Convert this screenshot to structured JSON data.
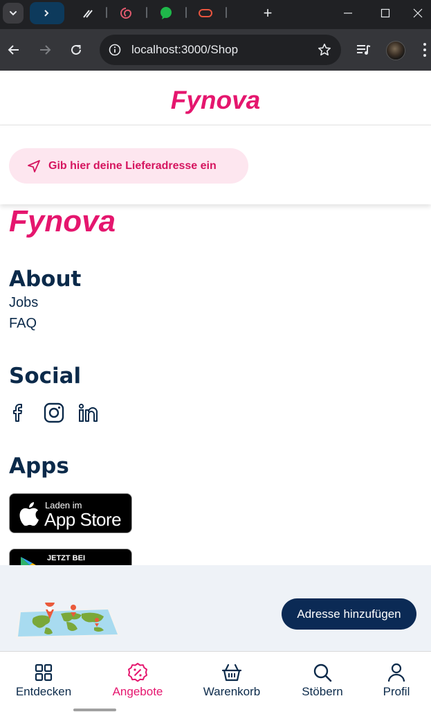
{
  "browser": {
    "url": "localhost:3000/Shop",
    "new_tab": "+",
    "colors": {
      "tabstrip": "#202124",
      "toolbar": "#35363a",
      "active_tab": "#0d3a5c"
    }
  },
  "header": {
    "brand": "Fynova"
  },
  "address_prompt": {
    "label": "Gib hier deine Lieferadresse ein"
  },
  "footer": {
    "brand": "Fynova",
    "about": {
      "heading": "About",
      "links": [
        "Jobs",
        "FAQ"
      ]
    },
    "social": {
      "heading": "Social",
      "icons": [
        "facebook-icon",
        "instagram-icon",
        "linkedin-icon"
      ]
    },
    "apps": {
      "heading": "Apps",
      "app_store": {
        "small": "Laden im",
        "big": "App Store"
      },
      "google_play": {
        "small": "JETZT BEI"
      }
    }
  },
  "address_banner": {
    "button": "Adresse hinzufügen"
  },
  "bottom_nav": {
    "items": [
      {
        "label": "Entdecken",
        "icon": "grid-icon"
      },
      {
        "label": "Angebote",
        "icon": "percent-badge-icon",
        "active": true
      },
      {
        "label": "Warenkorb",
        "icon": "basket-icon"
      },
      {
        "label": "Stöbern",
        "icon": "search-icon"
      },
      {
        "label": "Profil",
        "icon": "user-icon"
      }
    ]
  },
  "colors": {
    "brand_pink": "#e5166e",
    "navy": "#0b2a4a",
    "button_navy": "#0b2a55",
    "pill_bg": "#fde6ef",
    "banner_bg": "#eef2f7"
  }
}
